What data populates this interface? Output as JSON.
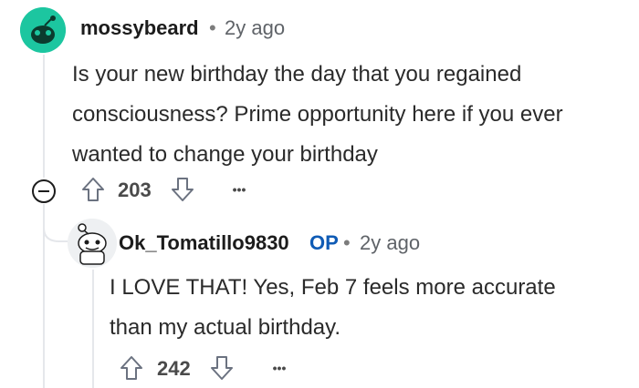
{
  "comments": [
    {
      "username": "mossybeard",
      "separator": "•",
      "time": "2y ago",
      "body_lines": [
        "Is your new birthday the day that you regained",
        "consciousness? Prime opportunity here if you ever",
        "wanted to change your birthday"
      ],
      "votes": "203",
      "more": "•••",
      "avatar_icon": "snoo-avatar-teal",
      "collapse_icon": "collapse-minus-icon"
    },
    {
      "username": "Ok_Tomatillo9830",
      "op_label": "OP",
      "separator": "•",
      "time": "2y ago",
      "body_lines": [
        "I LOVE THAT! Yes, Feb 7 feels more accurate",
        "than my actual birthday."
      ],
      "votes": "242",
      "more": "•••",
      "avatar_icon": "snoo-avatar-custom"
    }
  ],
  "colors": {
    "teal_avatar": "#1cc6a0",
    "op_blue": "#0f5bb5",
    "icon_gray": "#6b7280"
  }
}
